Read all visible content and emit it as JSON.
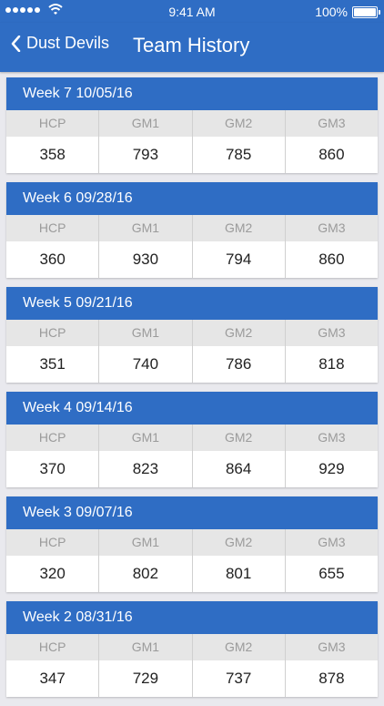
{
  "status_bar": {
    "time": "9:41 AM",
    "battery": "100%"
  },
  "nav": {
    "back_label": "Dust Devils",
    "title": "Team History"
  },
  "columns": [
    "HCP",
    "GM1",
    "GM2",
    "GM3"
  ],
  "weeks": [
    {
      "title": "Week 7 10/05/16",
      "values": [
        "358",
        "793",
        "785",
        "860"
      ]
    },
    {
      "title": "Week 6 09/28/16",
      "values": [
        "360",
        "930",
        "794",
        "860"
      ]
    },
    {
      "title": "Week 5 09/21/16",
      "values": [
        "351",
        "740",
        "786",
        "818"
      ]
    },
    {
      "title": "Week 4 09/14/16",
      "values": [
        "370",
        "823",
        "864",
        "929"
      ]
    },
    {
      "title": "Week 3 09/07/16",
      "values": [
        "320",
        "802",
        "801",
        "655"
      ]
    },
    {
      "title": "Week 2 08/31/16",
      "values": [
        "347",
        "729",
        "737",
        "878"
      ]
    }
  ]
}
